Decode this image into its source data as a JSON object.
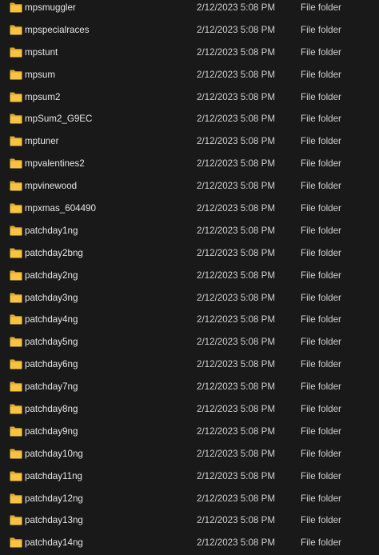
{
  "icon": "folder-icon",
  "colors": {
    "background": "#191919",
    "folder_body": "#f6c343",
    "folder_tab": "#e0a92a"
  },
  "files": [
    {
      "name": "mpsmuggler",
      "date": "2/12/2023 5:08 PM",
      "type": "File folder"
    },
    {
      "name": "mpspecialraces",
      "date": "2/12/2023 5:08 PM",
      "type": "File folder"
    },
    {
      "name": "mpstunt",
      "date": "2/12/2023 5:08 PM",
      "type": "File folder"
    },
    {
      "name": "mpsum",
      "date": "2/12/2023 5:08 PM",
      "type": "File folder"
    },
    {
      "name": "mpsum2",
      "date": "2/12/2023 5:08 PM",
      "type": "File folder"
    },
    {
      "name": "mpSum2_G9EC",
      "date": "2/12/2023 5:08 PM",
      "type": "File folder"
    },
    {
      "name": "mptuner",
      "date": "2/12/2023 5:08 PM",
      "type": "File folder"
    },
    {
      "name": "mpvalentines2",
      "date": "2/12/2023 5:08 PM",
      "type": "File folder"
    },
    {
      "name": "mpvinewood",
      "date": "2/12/2023 5:08 PM",
      "type": "File folder"
    },
    {
      "name": "mpxmas_604490",
      "date": "2/12/2023 5:08 PM",
      "type": "File folder"
    },
    {
      "name": "patchday1ng",
      "date": "2/12/2023 5:08 PM",
      "type": "File folder"
    },
    {
      "name": "patchday2bng",
      "date": "2/12/2023 5:08 PM",
      "type": "File folder"
    },
    {
      "name": "patchday2ng",
      "date": "2/12/2023 5:08 PM",
      "type": "File folder"
    },
    {
      "name": "patchday3ng",
      "date": "2/12/2023 5:08 PM",
      "type": "File folder"
    },
    {
      "name": "patchday4ng",
      "date": "2/12/2023 5:08 PM",
      "type": "File folder"
    },
    {
      "name": "patchday5ng",
      "date": "2/12/2023 5:08 PM",
      "type": "File folder"
    },
    {
      "name": "patchday6ng",
      "date": "2/12/2023 5:08 PM",
      "type": "File folder"
    },
    {
      "name": "patchday7ng",
      "date": "2/12/2023 5:08 PM",
      "type": "File folder"
    },
    {
      "name": "patchday8ng",
      "date": "2/12/2023 5:08 PM",
      "type": "File folder"
    },
    {
      "name": "patchday9ng",
      "date": "2/12/2023 5:08 PM",
      "type": "File folder"
    },
    {
      "name": "patchday10ng",
      "date": "2/12/2023 5:08 PM",
      "type": "File folder"
    },
    {
      "name": "patchday11ng",
      "date": "2/12/2023 5:08 PM",
      "type": "File folder"
    },
    {
      "name": "patchday12ng",
      "date": "2/12/2023 5:08 PM",
      "type": "File folder"
    },
    {
      "name": "patchday13ng",
      "date": "2/12/2023 5:08 PM",
      "type": "File folder"
    },
    {
      "name": "patchday14ng",
      "date": "2/12/2023 5:08 PM",
      "type": "File folder"
    }
  ]
}
